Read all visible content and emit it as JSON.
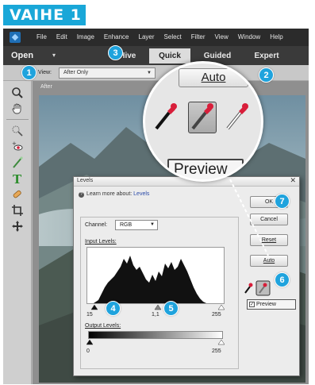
{
  "step_title": "VAIHE 1",
  "menubar": {
    "items": [
      "File",
      "Edit",
      "Image",
      "Enhance",
      "Layer",
      "Select",
      "Filter",
      "View",
      "Window",
      "Help"
    ]
  },
  "modebar": {
    "open_label": "Open",
    "open_caret": "▾",
    "tabs": [
      {
        "label": "eHive"
      },
      {
        "label": "Quick",
        "active": true
      },
      {
        "label": "Guided"
      },
      {
        "label": "Expert"
      }
    ]
  },
  "optionsbar": {
    "view_label": "View:",
    "view_value": "After Only"
  },
  "canvas": {
    "after_label": "After"
  },
  "levels": {
    "title": "Levels",
    "learn_text": "Learn more about:",
    "learn_link": "Levels",
    "buttons": {
      "ok": "OK",
      "cancel": "Cancel",
      "reset": "Reset",
      "auto": "Auto"
    },
    "channel_label": "Channel:",
    "channel_value": "RGB",
    "input_levels_label": "Input Levels:",
    "input_values": {
      "black": "15",
      "gamma": "1,1",
      "white": "255"
    },
    "output_levels_label": "Output Levels:",
    "output_values": {
      "black": "0",
      "white": "255"
    },
    "preview_label": "Preview",
    "preview_checked": true
  },
  "zoom": {
    "auto_label": "Auto",
    "preview_text": "Preview"
  },
  "badges": [
    "1",
    "2",
    "3",
    "4",
    "5",
    "6",
    "7"
  ],
  "colors": {
    "accent": "#1fa3dd",
    "title_bg": "#19a7d8",
    "menubar": "#2b2b2b",
    "eyedropper_red": "#d81e3a"
  }
}
